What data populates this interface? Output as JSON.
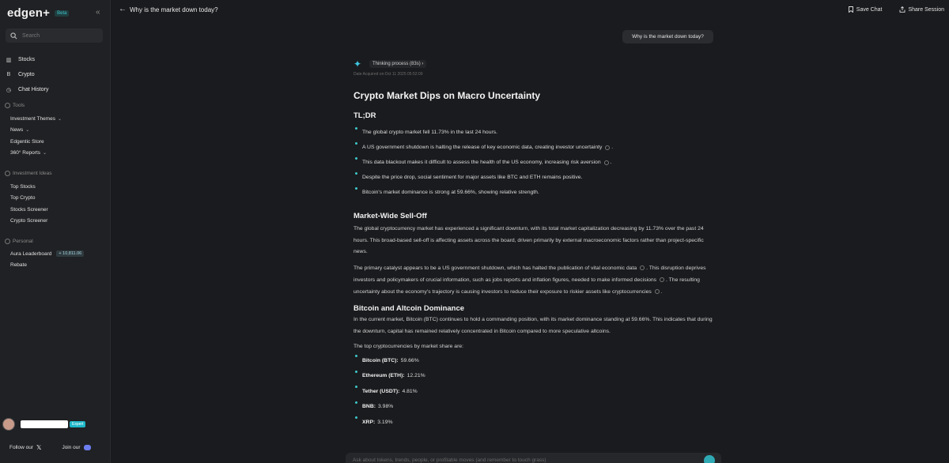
{
  "app": {
    "name": "edgen+",
    "badge": "Beta"
  },
  "sidebar": {
    "search_placeholder": "Search",
    "main": [
      {
        "label": "Stocks",
        "icon": "stocks-icon"
      },
      {
        "label": "Crypto",
        "icon": "bitcoin-icon"
      },
      {
        "label": "Chat History",
        "icon": "clock-icon"
      }
    ],
    "tools": {
      "heading": "Tools",
      "items": [
        "Investment Themes",
        "News",
        "Edgentic Store",
        "360° Reports"
      ]
    },
    "ideas": {
      "heading": "Investment Ideas",
      "items": [
        "Top Stocks",
        "Top Crypto",
        "Stocks Screener",
        "Crypto Screener"
      ]
    },
    "personal": {
      "heading": "Personal",
      "items": [
        "Aura Leaderboard",
        "Rebate"
      ],
      "aura_points": "+ 10,811.06"
    },
    "user_badge": "Expert",
    "footer": {
      "follow": "Follow our",
      "join": "Join our"
    }
  },
  "topbar": {
    "title": "Why is the market down today?",
    "save": "Save Chat",
    "share": "Share Session"
  },
  "user_message": "Why is the market down today?",
  "answer": {
    "thinking": "Thinking process (83s)",
    "meta": "Date Acquired on:Oct 11 2025 05:52:09",
    "title": "Crypto Market Dips on Macro Uncertainty",
    "tldr_heading": "TL;DR",
    "tldr": [
      "The global crypto market fell 11.73% in the last 24 hours.",
      "A US government shutdown is halting the release of key economic data, creating investor uncertainty",
      "This data blackout makes it difficult to assess the health of the US economy, increasing risk aversion",
      "Despite the price drop, social sentiment for major assets like BTC and ETH remains positive.",
      "Bitcoin's market dominance is strong at 59.66%, showing relative strength."
    ],
    "mw_heading": "Market-Wide Sell-Off",
    "mw_p1": "The global cryptocurrency market has experienced a significant downturn, with its total market capitalization decreasing by 11.73% over the past 24 hours. This broad-based sell-off is affecting assets across the board, driven primarily by external macroeconomic factors rather than project-specific news.",
    "mw_p2a": "The primary catalyst appears to be a US government shutdown, which has halted the publication of vital economic data",
    "mw_p2b": ". This disruption deprives investors and policymakers of crucial information, such as jobs reports and inflation figures, needed to make informed decisions",
    "mw_p2c": ". The resulting uncertainty about the economy's trajectory is causing investors to reduce their exposure to riskier assets like cryptocurrencies",
    "bad_heading": "Bitcoin and Altcoin Dominance",
    "bad_p1": "In the current market, Bitcoin (BTC) continues to hold a commanding position, with its market dominance standing at 59.66%. This indicates that during the downturn, capital has remained relatively concentrated in Bitcoin compared to more speculative altcoins.",
    "bad_p2": "The top cryptocurrencies by market share are:",
    "shares": [
      {
        "name": "Bitcoin (BTC):",
        "value": "59.66%"
      },
      {
        "name": "Ethereum (ETH):",
        "value": "12.21%"
      },
      {
        "name": "Tether (USDT):",
        "value": "4.81%"
      },
      {
        "name": "BNB:",
        "value": "3.98%"
      },
      {
        "name": "XRP:",
        "value": "3.19%"
      }
    ]
  },
  "composer_placeholder": "Ask about tokens, trends, people, or profitable moves (and remember to touch grass)",
  "colors": {
    "accent": "#3ec7c9",
    "background": "#1a1b1e",
    "sidebar": "#202124"
  }
}
